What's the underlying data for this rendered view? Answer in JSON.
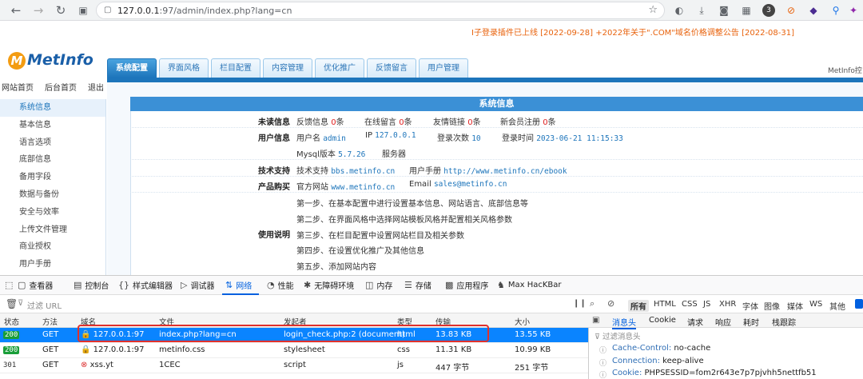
{
  "browser": {
    "url_host": "127.0.0.1",
    "url_rest": ":97/admin/index.php?lang=cn",
    "badge_count": "3"
  },
  "metinfo": {
    "notice": "I子登录插件已上线 [2022-09-28]  +2022年关于\".COM\"域名价格调整公告 [2022-08-31]",
    "logo": "MetInfo",
    "right_label": "MetInfo控",
    "tabs": [
      "系统配置",
      "界面风格",
      "栏目配置",
      "内容管理",
      "优化推广",
      "反馈留言",
      "用户管理"
    ],
    "toplinks": [
      "网站首页",
      "后台首页",
      "退出"
    ],
    "sidebar": [
      "系统信息",
      "基本信息",
      "语言选项",
      "底部信息",
      "备用字段",
      "数据与备份",
      "安全与效率",
      "上传文件管理",
      "商业授权",
      "用户手册"
    ],
    "panel_title": "系统信息",
    "unread": {
      "label": "未读信息",
      "feedback": "反馈信息",
      "feedback_n": "0",
      "feedback_unit": "条",
      "message": "在线留言",
      "message_n": "0",
      "message_unit": "条",
      "link": "友情链接",
      "link_n": "0",
      "link_unit": "条",
      "member": "新会员注册",
      "member_n": "0",
      "member_unit": "条"
    },
    "userinfo": {
      "label": "用户信息",
      "username_k": "用户名",
      "username": "admin",
      "ip_k": "IP",
      "ip": "127.0.0.1",
      "logins_k": "登录次数",
      "logins": "10",
      "time_k": "登录时间",
      "time": "2023-06-21 11:15:33",
      "mysql_k": "Mysql版本",
      "mysql": "5.7.26",
      "server_k": "服务器"
    },
    "support": {
      "label": "技术支持",
      "k": "技术支持",
      "v": "bbs.metinfo.cn",
      "manual_k": "用户手册",
      "manual": "http://www.metinfo.cn/ebook"
    },
    "purchase": {
      "label": "产品购买",
      "site_k": "官方网站",
      "site": "www.metinfo.cn",
      "email_k": "Email",
      "email": "sales@metinfo.cn"
    },
    "usage": {
      "label": "使用说明",
      "steps": [
        "第一步、在基本配置中进行设置基本信息、网站语言、底部信息等",
        "第二步、在界面风格中选择网站模板风格并配置相关风格参数",
        "第三步、在栏目配置中设置网站栏目及相关参数",
        "第四步、在设置优化推广及其他信息",
        "第五步、添加网站内容"
      ]
    }
  },
  "devtools": {
    "tools": [
      "查看器",
      "控制台",
      "样式编辑器",
      "调试器",
      "网络",
      "性能",
      "无障碍环境",
      "内存",
      "存储",
      "应用程序",
      "Max HacKBar"
    ],
    "filter_placeholder": "过滤 URL",
    "types": [
      "所有",
      "HTML",
      "CSS",
      "JS",
      "XHR",
      "字体",
      "图像",
      "媒体",
      "WS",
      "其他"
    ],
    "columns": [
      "状态",
      "方法",
      "域名",
      "文件",
      "发起者",
      "类型",
      "传输",
      "大小"
    ],
    "rows": [
      {
        "status": "200",
        "method": "GET",
        "domain": "127.0.0.1:97",
        "file": "index.php?lang=cn",
        "initiator": "login_check.php:2 (document)",
        "type": "html",
        "transfer": "13.83 KB",
        "size": "13.55 KB"
      },
      {
        "status": "200",
        "method": "GET",
        "domain": "127.0.0.1:97",
        "file": "metinfo.css",
        "initiator": "stylesheet",
        "type": "css",
        "transfer": "11.31 KB",
        "size": "10.99 KB"
      },
      {
        "status": "301",
        "method": "GET",
        "domain": "xss.yt",
        "file": "1CEC",
        "initiator": "script",
        "type": "js",
        "transfer": "447 字节",
        "size": "251 字节"
      }
    ],
    "detail_tabs": [
      "消息头",
      "Cookie",
      "请求",
      "响应",
      "耗时",
      "栈跟踪"
    ],
    "header_filter": "过滤消息头",
    "headers": [
      {
        "k": "Cache-Control:",
        "v": "no-cache"
      },
      {
        "k": "Connection:",
        "v": "keep-alive"
      },
      {
        "k": "Cookie:",
        "v": "PHPSESSID=fom2r643e7p7pjvhh5nettfb51"
      }
    ]
  }
}
